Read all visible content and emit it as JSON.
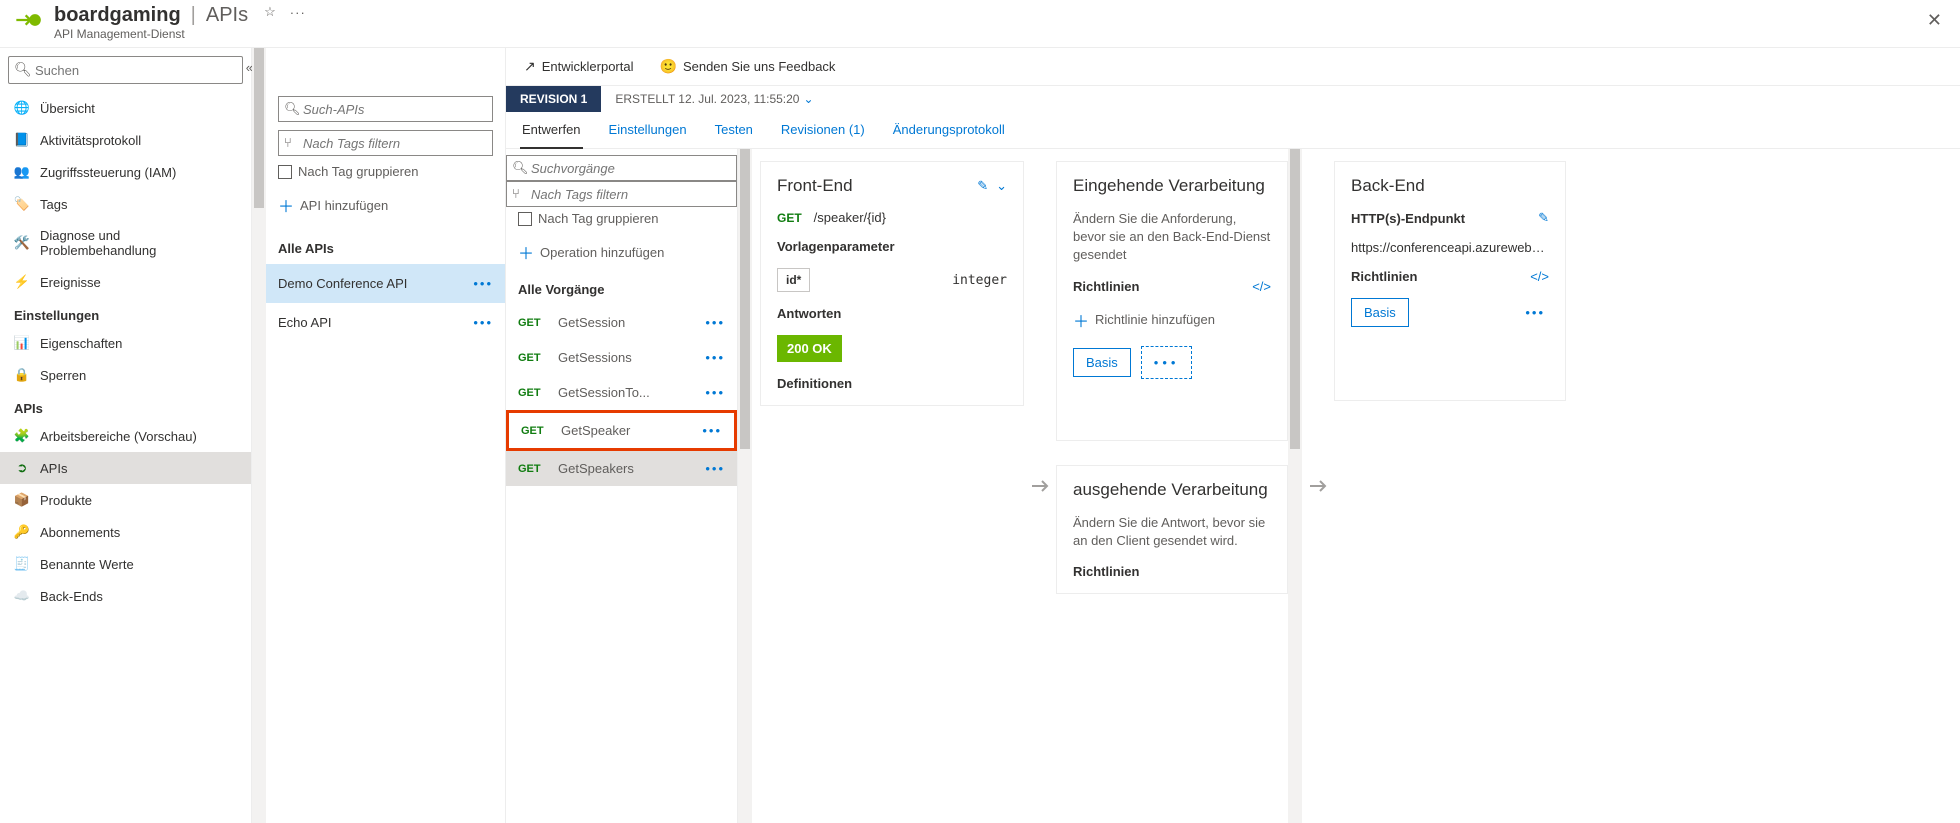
{
  "header": {
    "service_name": "boardgaming",
    "section": "APIs",
    "subtitle": "API Management-Dienst"
  },
  "sidebar": {
    "search_placeholder": "Suchen",
    "items_top": [
      {
        "label": "Übersicht",
        "icon": "globe"
      },
      {
        "label": "Aktivitätsprotokoll",
        "icon": "log"
      },
      {
        "label": "Zugriffssteuerung (IAM)",
        "icon": "people"
      },
      {
        "label": "Tags",
        "icon": "tag"
      },
      {
        "label": "Diagnose und Problembehandlung",
        "icon": "wrench"
      },
      {
        "label": "Ereignisse",
        "icon": "bolt"
      }
    ],
    "group_settings": "Einstellungen",
    "items_settings": [
      {
        "label": "Eigenschaften",
        "icon": "sliders"
      },
      {
        "label": "Sperren",
        "icon": "lock"
      }
    ],
    "group_apis": "APIs",
    "items_apis": [
      {
        "label": "Arbeitsbereiche (Vorschau)",
        "icon": "workspace"
      },
      {
        "label": "APIs",
        "icon": "api",
        "active": true
      },
      {
        "label": "Produkte",
        "icon": "box"
      },
      {
        "label": "Abonnements",
        "icon": "key"
      },
      {
        "label": "Benannte Werte",
        "icon": "table"
      },
      {
        "label": "Back-Ends",
        "icon": "cloud"
      }
    ]
  },
  "toolbar": {
    "dev_portal": "Entwicklerportal",
    "feedback": "Senden Sie uns Feedback"
  },
  "api_list": {
    "search_placeholder": "Such-APIs",
    "tag_filter_placeholder": "Nach Tags filtern",
    "group_by_tag": "Nach Tag gruppieren",
    "add_api": "API hinzufügen",
    "all_apis": "Alle APIs",
    "items": [
      {
        "label": "Demo Conference API",
        "selected": true
      },
      {
        "label": "Echo API"
      }
    ]
  },
  "revision": {
    "badge": "REVISION 1",
    "created": "ERSTELLT 12. Jul. 2023, 11:55:20"
  },
  "tabs": [
    {
      "label": "Entwerfen",
      "active": true
    },
    {
      "label": "Einstellungen"
    },
    {
      "label": "Testen"
    },
    {
      "label": "Revisionen (1)"
    },
    {
      "label": "Änderungsprotokoll"
    }
  ],
  "ops": {
    "search_placeholder": "Suchvorgänge",
    "tag_filter_placeholder": "Nach Tags filtern",
    "group_by_tag": "Nach Tag gruppieren",
    "add_operation": "Operation hinzufügen",
    "all_ops": "Alle Vorgänge",
    "items": [
      {
        "method": "GET",
        "name": "GetSession"
      },
      {
        "method": "GET",
        "name": "GetSessions"
      },
      {
        "method": "GET",
        "name": "GetSessionTo..."
      },
      {
        "method": "GET",
        "name": "GetSpeaker",
        "highlight": true
      },
      {
        "method": "GET",
        "name": "GetSpeakers",
        "selected": true
      }
    ]
  },
  "frontend": {
    "title": "Front-End",
    "method": "GET",
    "path": "/speaker/{id}",
    "template_params_label": "Vorlagenparameter",
    "param_name": "id*",
    "param_type": "integer",
    "responses_label": "Antworten",
    "response_badge": "200 OK",
    "definitions_label": "Definitionen"
  },
  "inbound": {
    "title": "Eingehende Verarbeitung",
    "desc": "Ändern Sie die Anforderung, bevor sie an den Back-End-Dienst gesendet",
    "policies_label": "Richtlinien",
    "add_policy": "Richtlinie hinzufügen",
    "basis": "Basis"
  },
  "outbound": {
    "title": "ausgehende Verarbeitung",
    "desc": "Ändern Sie die Antwort, bevor sie an den Client gesendet wird.",
    "policies_label": "Richtlinien"
  },
  "backend": {
    "title": "Back-End",
    "endpoint_label": "HTTP(s)-Endpunkt",
    "url": "https://conferenceapi.azurewebsit..",
    "policies_label": "Richtlinien",
    "basis": "Basis"
  }
}
